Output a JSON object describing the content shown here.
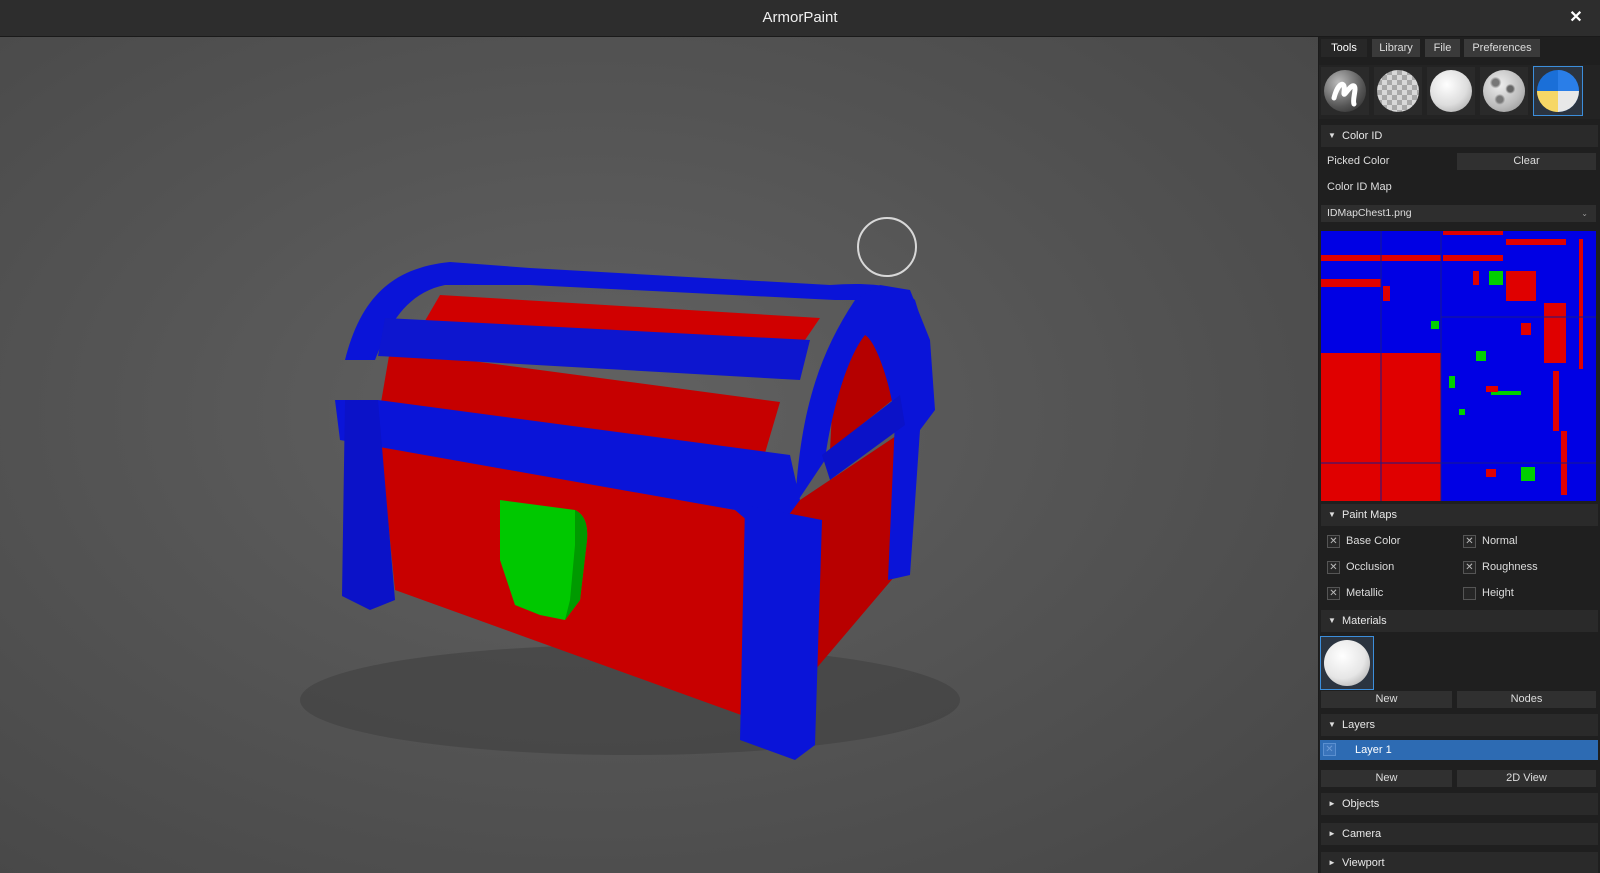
{
  "window": {
    "title": "ArmorPaint",
    "close_glyph": "✕"
  },
  "tabs": [
    {
      "label": "Tools"
    },
    {
      "label": "Library"
    },
    {
      "label": "File"
    },
    {
      "label": "Preferences"
    }
  ],
  "tools": [
    {
      "name": "brush-icon"
    },
    {
      "name": "eraser-icon"
    },
    {
      "name": "fill-icon"
    },
    {
      "name": "decal-icon"
    },
    {
      "name": "colorid-icon",
      "selected": true
    }
  ],
  "color_id": {
    "header": "Color ID",
    "picked_color_label": "Picked Color",
    "clear_button": "Clear",
    "map_label": "Color ID Map",
    "map_file": "IDMapChest1.png"
  },
  "paint_maps": {
    "header": "Paint Maps",
    "items": [
      {
        "label": "Base Color",
        "checked": true
      },
      {
        "label": "Normal",
        "checked": true
      },
      {
        "label": "Occlusion",
        "checked": true
      },
      {
        "label": "Roughness",
        "checked": true
      },
      {
        "label": "Metallic",
        "checked": true
      },
      {
        "label": "Height",
        "checked": false
      }
    ]
  },
  "materials": {
    "header": "Materials",
    "new_button": "New",
    "nodes_button": "Nodes"
  },
  "layers": {
    "header": "Layers",
    "items": [
      {
        "label": "Layer 1",
        "visible": true
      }
    ],
    "new_button": "New",
    "view2d_button": "2D View"
  },
  "collapsed_sections": [
    {
      "label": "Objects"
    },
    {
      "label": "Camera"
    },
    {
      "label": "Viewport"
    }
  ],
  "glyphs": {
    "expanded": "▼",
    "collapsed": "►",
    "check": "✕",
    "dropdown": "⌄"
  },
  "colors": {
    "accent": "#3c8edb",
    "layer_selected": "#2d6bb3",
    "chest_blue": "#0a14d8",
    "chest_red": "#d20000",
    "chest_green": "#00c800"
  }
}
